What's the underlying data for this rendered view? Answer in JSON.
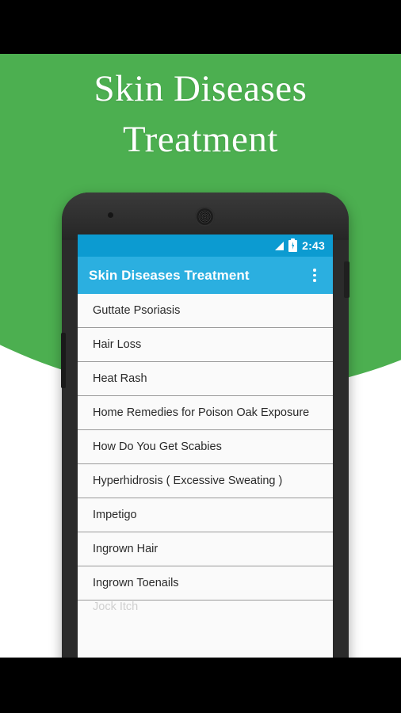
{
  "hero": {
    "title": "Skin Diseases\nTreatment",
    "background_color": "#4caf50",
    "text_color": "#ffffff"
  },
  "device": {
    "type": "android-phone",
    "body_color": "#2b2b2b",
    "front_camera": "front-camera",
    "earpiece": "earpiece-speaker",
    "power_button": "power-button",
    "volume_button": "volume-button"
  },
  "status_bar": {
    "time": "2:43",
    "background_color": "#0c9bd1",
    "icons": [
      "signal-icon",
      "battery-charging-icon"
    ]
  },
  "app_bar": {
    "title": "Skin Diseases Treatment",
    "background_color": "#2bafe0",
    "overflow_menu": "overflow-menu-icon"
  },
  "list": {
    "background_color": "#fafafa",
    "divider_color": "#9a9a9a",
    "items": [
      {
        "label": "Guttate Psoriasis"
      },
      {
        "label": "Hair Loss"
      },
      {
        "label": "Heat Rash"
      },
      {
        "label": "Home Remedies for Poison Oak Exposure"
      },
      {
        "label": "How Do You Get Scabies"
      },
      {
        "label": "Hyperhidrosis ( Excessive Sweating )"
      },
      {
        "label": "Impetigo"
      },
      {
        "label": "Ingrown Hair"
      },
      {
        "label": "Ingrown Toenails"
      }
    ],
    "partial_item": {
      "label": "Jock Itch"
    }
  }
}
